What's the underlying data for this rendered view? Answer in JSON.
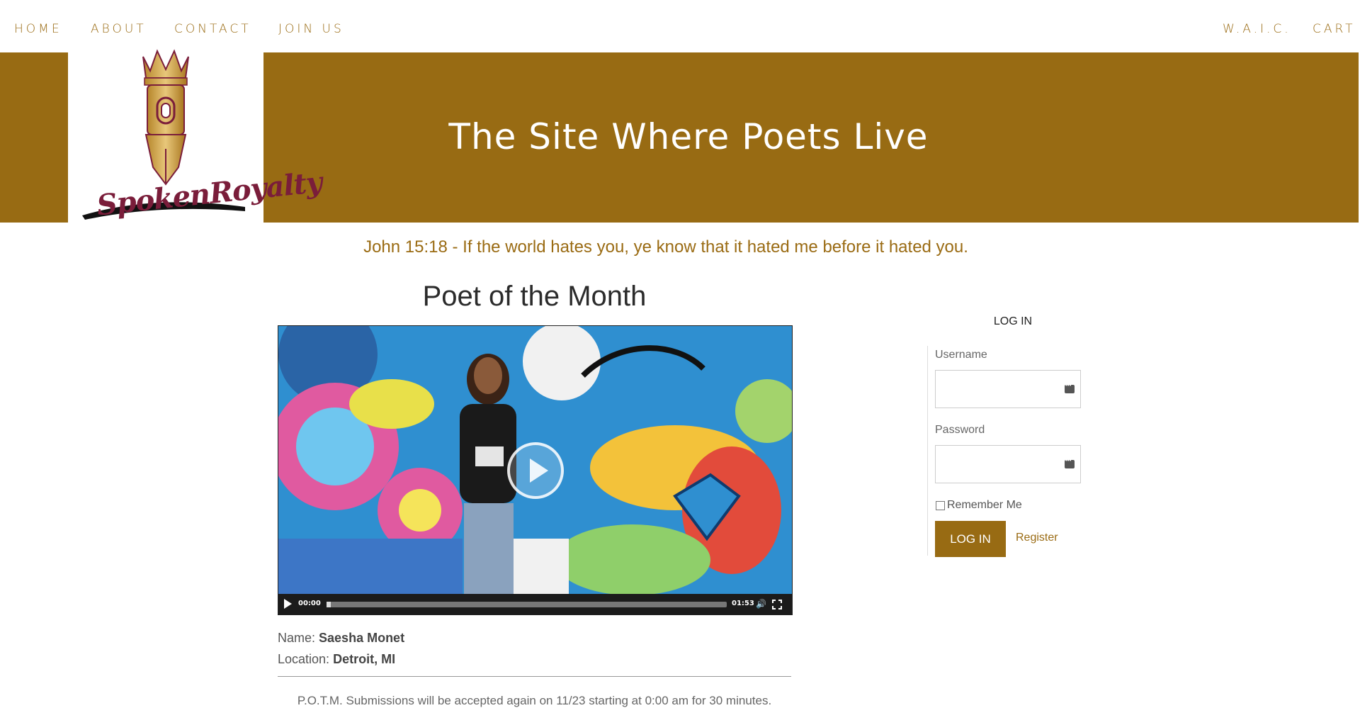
{
  "nav": {
    "left": [
      "HOME",
      "ABOUT",
      "CONTACT",
      "JOIN US"
    ],
    "right": [
      "W.A.I.C.",
      "CART"
    ]
  },
  "brand": {
    "logo_text": "SpokenRoyalty"
  },
  "banner": {
    "title": "The Site Where Poets Live"
  },
  "verse": "John 15:18 - If the world hates you, ye know that it hated me before it hated you.",
  "poet": {
    "heading": "Poet of the Month",
    "video": {
      "current_time": "00:00",
      "duration": "01:53",
      "progress": 0.01
    },
    "name_label": "Name:",
    "name": "Saesha Monet",
    "location_label": "Location:",
    "location": "Detroit, MI",
    "notice": "P.O.T.M. Submissions will be accepted again on 11/23 starting at 0:00 am for 30 minutes."
  },
  "login": {
    "title": "LOG IN",
    "username_label": "Username",
    "password_label": "Password",
    "remember_label": "Remember Me",
    "button_label": "LOG IN",
    "register_label": "Register"
  },
  "colors": {
    "accent": "#986b13",
    "accent_text": "#9a6b13"
  },
  "icons": [
    "crown-pen-logo-icon",
    "play-icon",
    "volume-icon",
    "fullscreen-icon",
    "password-manager-icon"
  ]
}
